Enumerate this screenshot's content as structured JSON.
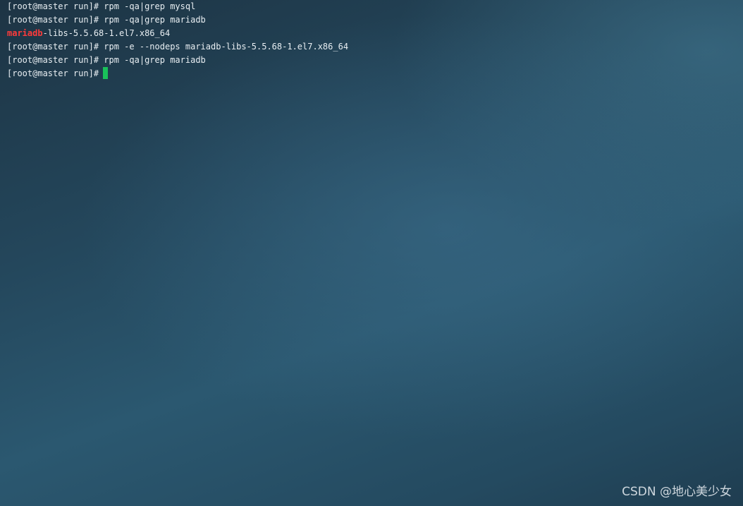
{
  "terminal": {
    "lines": [
      {
        "prompt": "[root@master run]#",
        "command": " rpm -qa|grep mysql"
      },
      {
        "prompt": "[root@master run]#",
        "command": " rpm -qa|grep mariadb"
      },
      {
        "match": "mariadb",
        "rest": "-libs-5.5.68-1.el7.x86_64"
      },
      {
        "prompt": "[root@master run]#",
        "command": " rpm -e --nodeps mariadb-libs-5.5.68-1.el7.x86_64"
      },
      {
        "prompt": "[root@master run]#",
        "command": " rpm -qa|grep mariadb"
      },
      {
        "prompt": "[root@master run]#",
        "command": ""
      }
    ],
    "cursor_color": "#19c15a",
    "match_color": "#ff3b3b"
  },
  "watermark": {
    "text": "CSDN @地心美少女"
  }
}
